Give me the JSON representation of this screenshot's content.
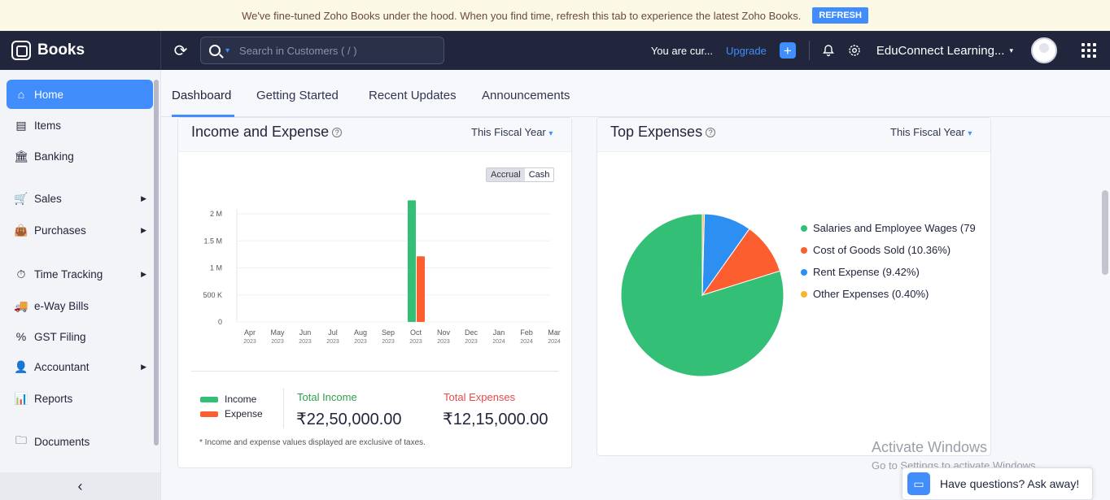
{
  "banner": {
    "message": "We've fine-tuned Zoho Books under the hood. When you find time, refresh this tab to experience the latest Zoho Books.",
    "refresh_label": "REFRESH"
  },
  "topbar": {
    "app_name": "Books",
    "search_placeholder": "Search in Customers ( / )",
    "trial_text": "You are cur...",
    "upgrade_label": "Upgrade",
    "org_name": "EduConnect Learning..."
  },
  "sidebar": {
    "items": [
      {
        "label": "Home",
        "icon": "home-icon",
        "active": true
      },
      {
        "label": "Items",
        "icon": "items-icon"
      },
      {
        "label": "Banking",
        "icon": "bank-icon"
      },
      {
        "label": "Sales",
        "icon": "cart-icon",
        "submenu": true
      },
      {
        "label": "Purchases",
        "icon": "bag-icon",
        "submenu": true
      },
      {
        "label": "Time Tracking",
        "icon": "timer-icon",
        "submenu": true
      },
      {
        "label": "e-Way Bills",
        "icon": "truck-icon"
      },
      {
        "label": "GST Filing",
        "icon": "percent-icon"
      },
      {
        "label": "Accountant",
        "icon": "accountant-icon",
        "submenu": true
      },
      {
        "label": "Reports",
        "icon": "reports-icon"
      },
      {
        "label": "Documents",
        "icon": "folder-icon"
      }
    ]
  },
  "tabs": [
    {
      "label": "Dashboard"
    },
    {
      "label": "Getting Started"
    },
    {
      "label": "Recent Updates"
    },
    {
      "label": "Announcements"
    }
  ],
  "income_expense": {
    "title": "Income and Expense",
    "period": "This Fiscal Year",
    "toggle": {
      "accrual": "Accrual",
      "cash": "Cash"
    },
    "legend": {
      "income": "Income",
      "expense": "Expense"
    },
    "total_income_label": "Total Income",
    "total_income_value": "₹22,50,000.00",
    "total_expense_label": "Total Expenses",
    "total_expense_value": "₹12,15,000.00",
    "footnote": "* Income and expense values displayed are exclusive of taxes."
  },
  "top_expenses": {
    "title": "Top Expenses",
    "period": "This Fiscal Year"
  },
  "colors": {
    "accent": "#408dfb",
    "income": "#34bf76",
    "expense": "#fc5e2f",
    "rent": "#2d8ff2",
    "other": "#f6b62c",
    "topbar": "#21263c"
  },
  "chart_data": [
    {
      "type": "bar",
      "categories": [
        "Apr",
        "May",
        "Jun",
        "Jul",
        "Aug",
        "Sep",
        "Oct",
        "Nov",
        "Dec",
        "Jan",
        "Feb",
        "Mar"
      ],
      "category_years": [
        "2023",
        "2023",
        "2023",
        "2023",
        "2023",
        "2023",
        "2023",
        "2023",
        "2023",
        "2024",
        "2024",
        "2024"
      ],
      "series": [
        {
          "name": "Income",
          "values": [
            0,
            0,
            0,
            0,
            0,
            0,
            2250000,
            0,
            0,
            0,
            0,
            0
          ]
        },
        {
          "name": "Expense",
          "values": [
            0,
            0,
            0,
            0,
            0,
            0,
            1215000,
            0,
            0,
            0,
            0,
            0
          ]
        }
      ],
      "yticks": [
        "0",
        "500 K",
        "1 M",
        "1.5 M",
        "2 M"
      ],
      "ylim": [
        0,
        2000000
      ],
      "legend_position": "bottom-left"
    },
    {
      "type": "pie",
      "labels": [
        "Salaries and Employee Wages (79",
        "Cost of Goods Sold (10.36%)",
        "Rent Expense (9.42%)",
        "Other Expenses (0.40%)"
      ],
      "values": [
        79.82,
        10.36,
        9.42,
        0.4
      ],
      "legend_position": "right"
    }
  ],
  "watermark": {
    "line1": "Activate Windows",
    "line2": "Go to Settings to activate Windows."
  },
  "help_widget": {
    "label": "Have questions? Ask away!"
  }
}
